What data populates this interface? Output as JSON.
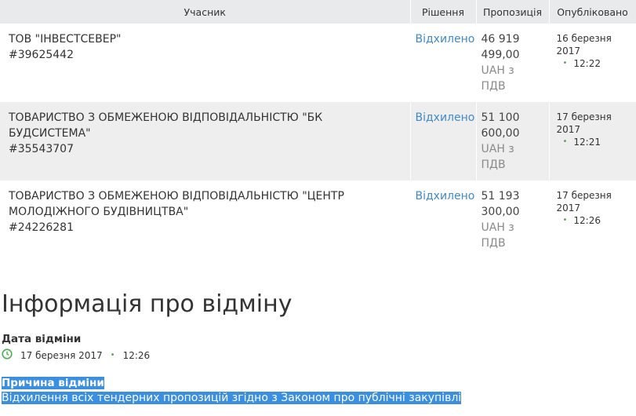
{
  "table": {
    "headers": {
      "participant": "Учасник",
      "decision": "Рішення",
      "proposal": "Пропозиція",
      "published": "Опубліковано"
    },
    "rows": [
      {
        "name": "ТОВ \"ІНВЕСТСЕВЕР\"",
        "code": "#39625442",
        "decision": "Відхилено",
        "amount1": "46 919",
        "amount2": "499,00",
        "cur1": "UAH з",
        "cur2": "ПДВ",
        "date": "16 березня 2017",
        "time": "12:22"
      },
      {
        "name": "ТОВАРИСТВО З ОБМЕЖЕНОЮ ВІДПОВІДАЛЬНІСТЮ \"БК БУДСИСТЕМА\"",
        "code": "#35543707",
        "decision": "Відхилено",
        "amount1": "51 100",
        "amount2": "600,00",
        "cur1": "UAH з",
        "cur2": "ПДВ",
        "date": "17 березня 2017",
        "time": "12:21"
      },
      {
        "name": "ТОВАРИСТВО З ОБМЕЖЕНОЮ ВІДПОВІДАЛЬНІСТЮ \"ЦЕНТР МОЛОДІЖНОГО БУДІВНИЦТВА\"",
        "code": "#24226281",
        "decision": "Відхилено",
        "amount1": "51 193",
        "amount2": "300,00",
        "cur1": "UAH з",
        "cur2": "ПДВ",
        "date": "17 березня 2017",
        "time": "12:26"
      }
    ]
  },
  "cancellation": {
    "title": "Інформація про відміну",
    "date_label": "Дата відміни",
    "date": "17 березня 2017",
    "time": "12:26",
    "reason_label": "Причина відміни",
    "reason": "Відхилення всіх тендерних пропозицій згідно з Законом про публічні закупівлі"
  }
}
